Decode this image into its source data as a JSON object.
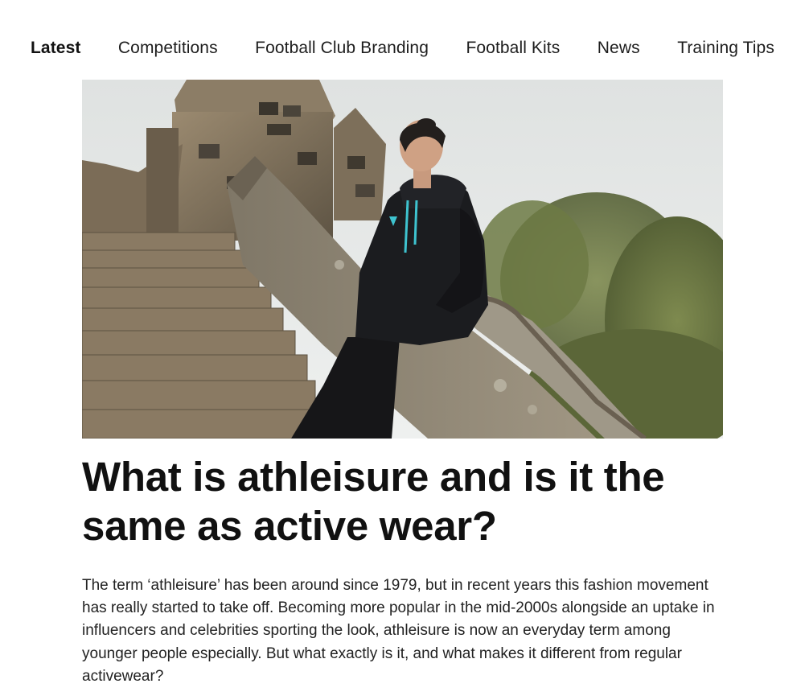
{
  "nav": {
    "items": [
      {
        "label": "Latest",
        "active": true
      },
      {
        "label": "Competitions",
        "active": false
      },
      {
        "label": "Football Club Branding",
        "active": false
      },
      {
        "label": "Football Kits",
        "active": false
      },
      {
        "label": "News",
        "active": false
      },
      {
        "label": "Training Tips",
        "active": false
      }
    ]
  },
  "article": {
    "title": "What is athleisure and is it the same as active wear?",
    "intro": "The term ‘athleisure’ has been around since 1979, but in recent years this fashion movement has really started to take off. Becoming more popular in the mid-2000s alongside an uptake in influencers and celebrities sporting the look, athleisure is now an everyday term among younger people especially. But what exactly is it, and what makes it different from regular activewear?"
  },
  "colors": {
    "text": "#111111",
    "body_text": "#222222",
    "hoodie": "#1b1c1f",
    "hoodie_accent": "#3ec3cf",
    "stone": "#8a7a63",
    "sky": "#e6e8e7",
    "foliage": "#6f7b45"
  },
  "icons": {
    "hero_image": "woman-in-black-hoodie-on-stone-stairs"
  }
}
